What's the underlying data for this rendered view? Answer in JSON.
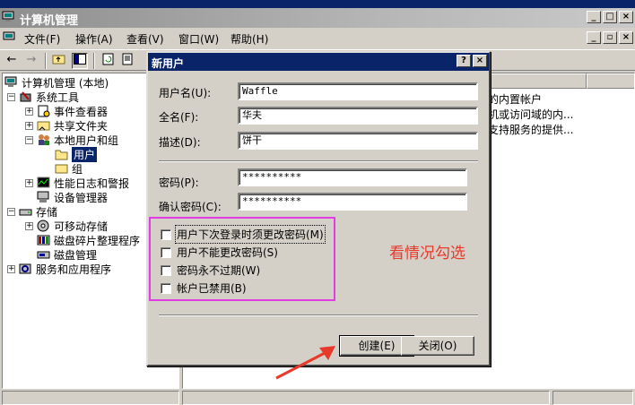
{
  "window": {
    "title": "计算机管理"
  },
  "menubar": {
    "items": [
      "文件(F)",
      "操作(A)",
      "查看(V)",
      "窗口(W)",
      "帮助(H)"
    ]
  },
  "tree": {
    "root": "计算机管理 (本地)",
    "system_tools": "系统工具",
    "event_viewer": "事件查看器",
    "shared_folders": "共享文件夹",
    "local_users_groups": "本地用户和组",
    "users": "用户",
    "groups": "组",
    "perf_logs": "性能日志和警报",
    "device_manager": "设备管理器",
    "storage": "存储",
    "removable_storage": "可移动存储",
    "defrag": "磁盘碎片整理程序",
    "disk_mgmt": "磁盘管理",
    "services_apps": "服务和应用程序"
  },
  "list": {
    "descriptions": [
      "的内置帐户",
      "机或访问域的内...",
      "支持服务的提供..."
    ]
  },
  "dialog": {
    "title": "新用户",
    "help_btn": "?",
    "close_btn": "×",
    "username_label": "用户名(U):",
    "username_value": "Waffle",
    "fullname_label": "全名(F):",
    "fullname_value": "华夫",
    "desc_label": "描述(D):",
    "desc_value": "饼干",
    "password_label": "密码(P):",
    "password_value": "**********",
    "confirm_label": "确认密码(C):",
    "confirm_value": "**********",
    "checkboxes": [
      {
        "label": "用户下次登录时须更改密码(M)",
        "checked": false
      },
      {
        "label": "用户不能更改密码(S)",
        "checked": false
      },
      {
        "label": "密码永不过期(W)",
        "checked": false
      },
      {
        "label": "帐户已禁用(B)",
        "checked": false
      }
    ],
    "create_btn": "创建(E)",
    "close_label": "关闭(O)"
  },
  "annotation": {
    "text": "看情况勾选",
    "color": "#e8392a",
    "box_color": "#e23de2"
  },
  "colors": {
    "titlebar_active": "#0a246a",
    "face": "#d4d0c8"
  }
}
